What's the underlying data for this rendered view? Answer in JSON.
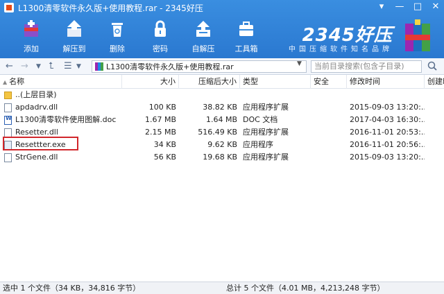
{
  "window": {
    "title": "L1300清零软件永久版+使用教程.rar - 2345好压",
    "controls": [
      "▾",
      "—",
      "□",
      "✕"
    ]
  },
  "toolbar": [
    {
      "label": "添加",
      "icon": "add-archive-icon"
    },
    {
      "label": "解压到",
      "icon": "extract-icon"
    },
    {
      "label": "删除",
      "icon": "trash-icon"
    },
    {
      "label": "密码",
      "icon": "lock-icon"
    },
    {
      "label": "自解压",
      "icon": "self-extract-icon"
    },
    {
      "label": "工具箱",
      "icon": "toolbox-icon"
    }
  ],
  "brand": {
    "name": "2345好压",
    "slogan": "中国压缩软件知名品牌"
  },
  "address": {
    "path": "L1300清零软件永久版+使用教程.rar",
    "search_placeholder": "当前目录搜索(包含子目录)"
  },
  "columns": [
    "名称",
    "大小",
    "压缩后大小",
    "类型",
    "安全",
    "修改时间",
    "创建时"
  ],
  "files": [
    {
      "name": "..(上层目录)",
      "size": "",
      "packed": "",
      "type": "",
      "security": "",
      "modified": "",
      "icon": "folder-icon"
    },
    {
      "name": "apdadrv.dll",
      "size": "100 KB",
      "packed": "38.82 KB",
      "type": "应用程序扩展",
      "security": "",
      "modified": "2015-09-03 13:20:...",
      "icon": "dll-icon"
    },
    {
      "name": "L1300清零软件使用图解.doc",
      "size": "1.67 MB",
      "packed": "1.64 MB",
      "type": "DOC 文档",
      "security": "",
      "modified": "2017-04-03 16:30:...",
      "icon": "doc-icon"
    },
    {
      "name": "Resetter.dll",
      "size": "2.15 MB",
      "packed": "516.49 KB",
      "type": "应用程序扩展",
      "security": "",
      "modified": "2016-11-01 20:53:...",
      "icon": "dll-icon"
    },
    {
      "name": "Resettter.exe",
      "size": "34 KB",
      "packed": "9.62 KB",
      "type": "应用程序",
      "security": "",
      "modified": "2016-11-01 20:56:...",
      "icon": "exe-icon"
    },
    {
      "name": "StrGene.dll",
      "size": "56 KB",
      "packed": "19.68 KB",
      "type": "应用程序扩展",
      "security": "",
      "modified": "2015-09-03 13:20:...",
      "icon": "dll-icon"
    }
  ],
  "status": {
    "selected": "选中 1 个文件（34 KB，34,816 字节）",
    "total": "总计 5 个文件（4.01 MB，4,213,248 字节）"
  },
  "colors": {
    "accent": "#2a78d0",
    "highlight": "#d1262b"
  }
}
